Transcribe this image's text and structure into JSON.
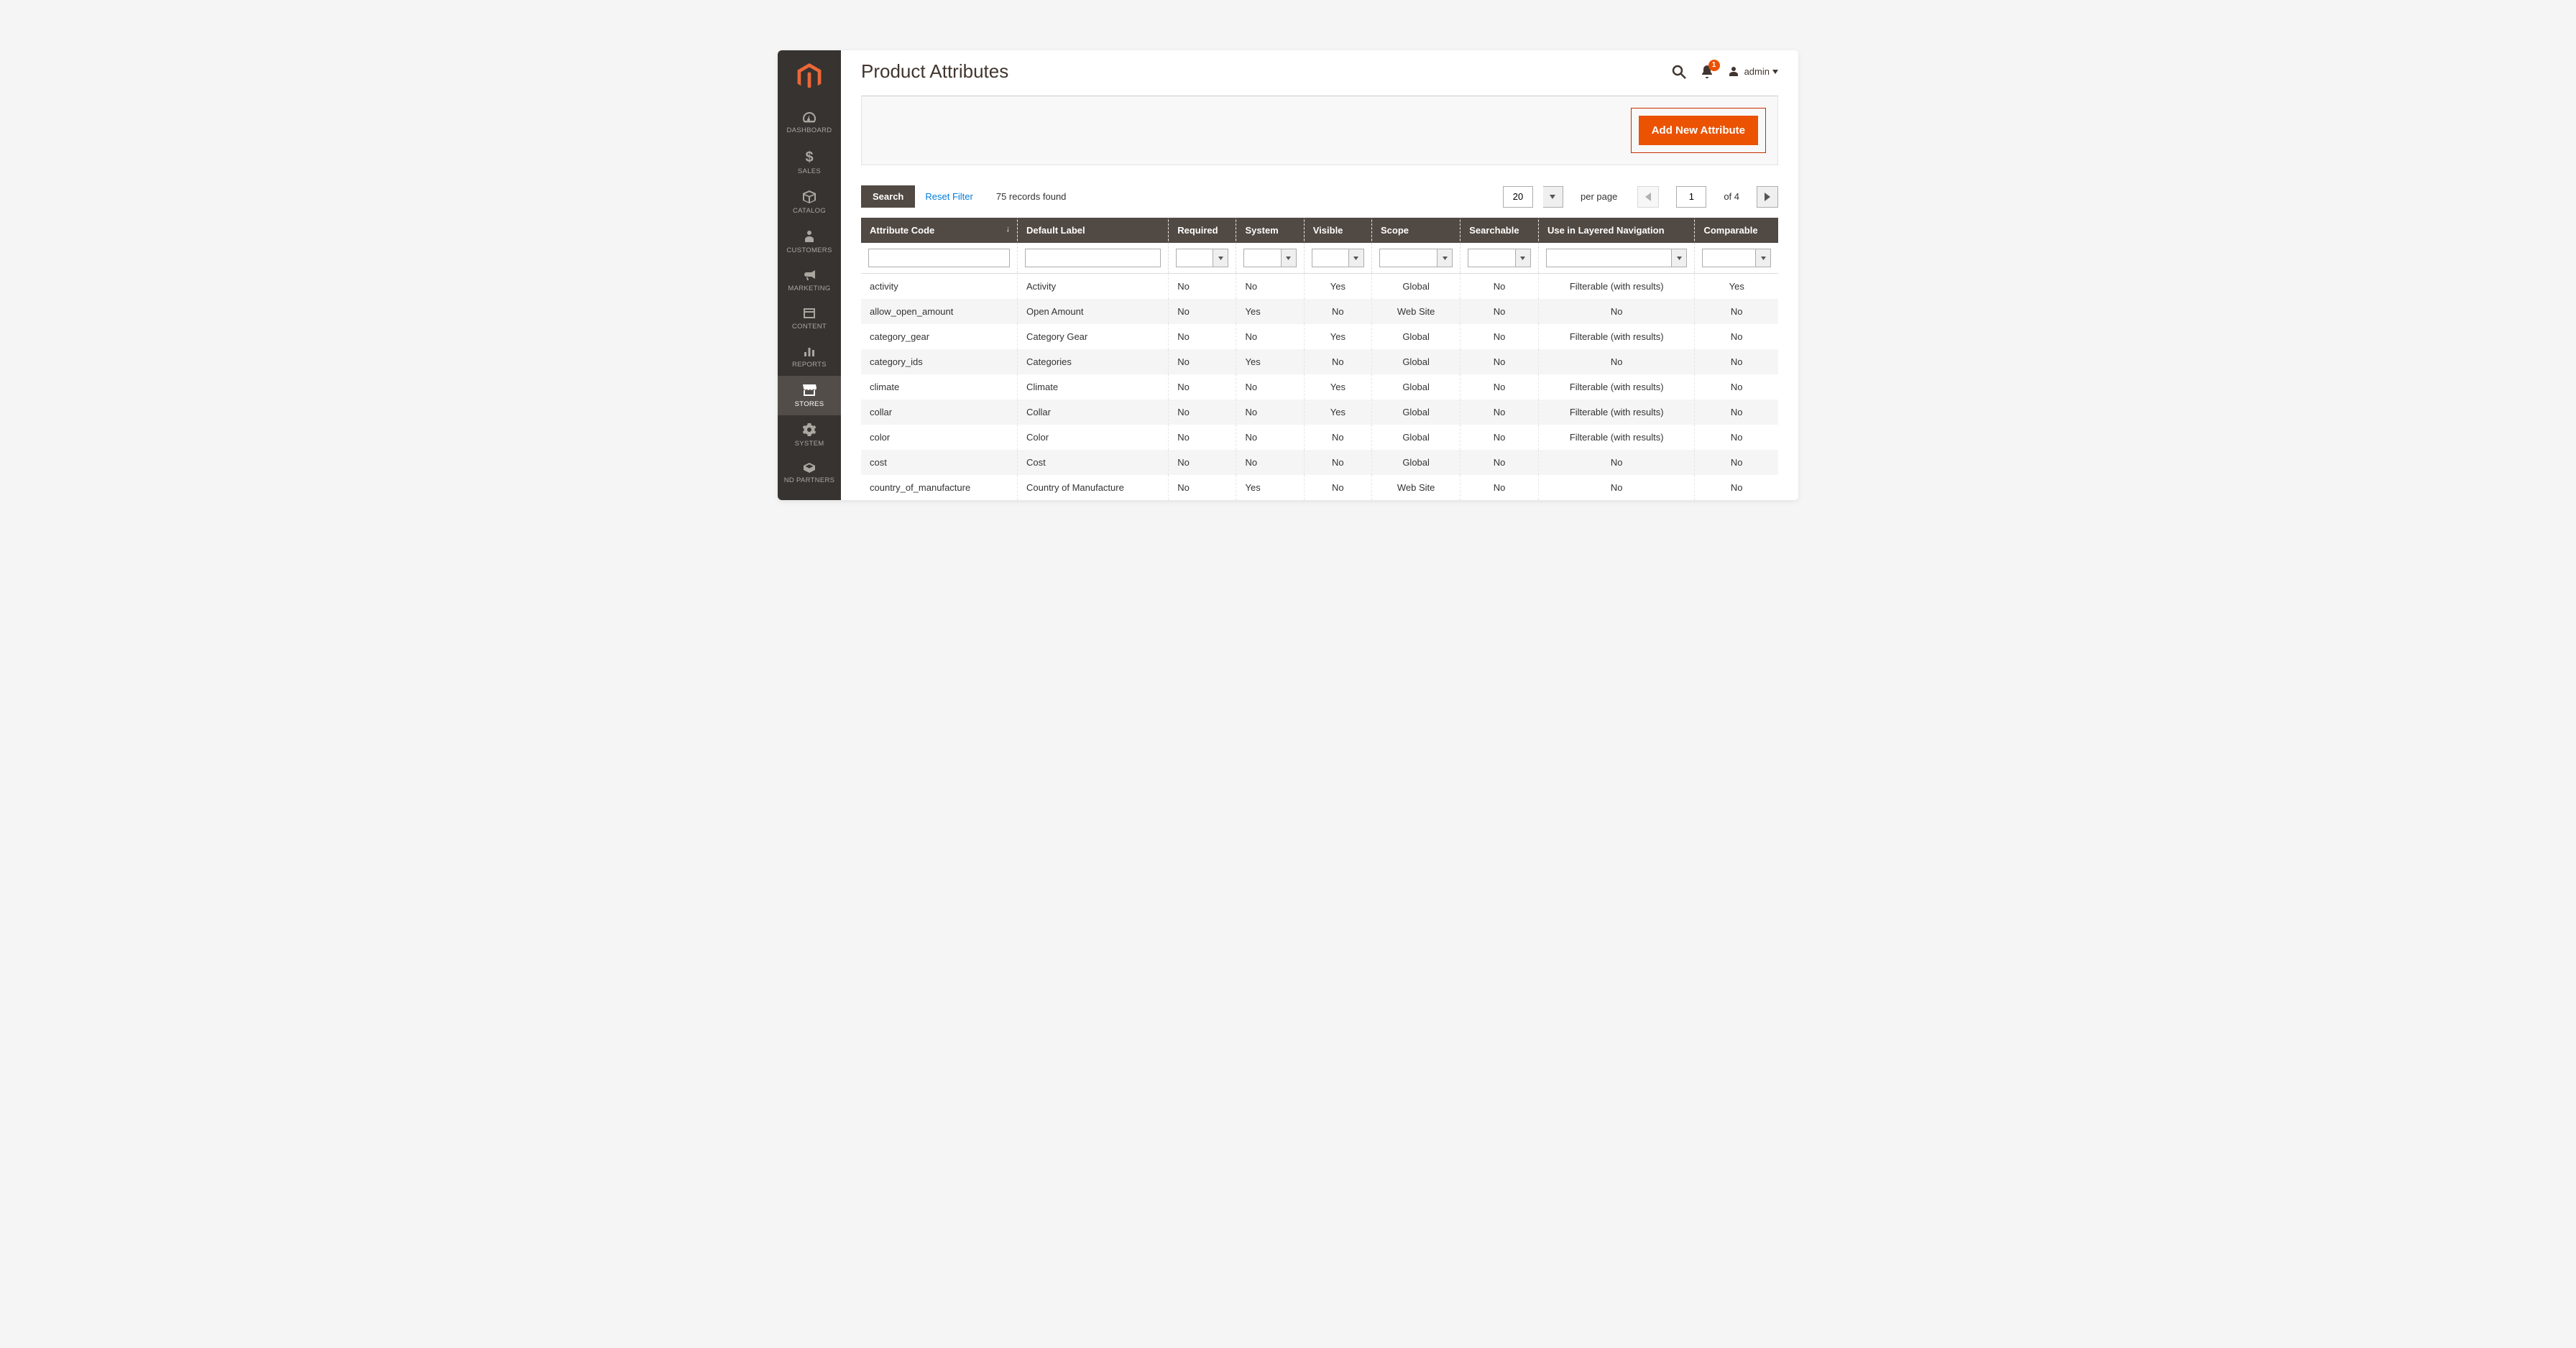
{
  "sidebar": {
    "items": [
      {
        "label": "DASHBOARD"
      },
      {
        "label": "SALES"
      },
      {
        "label": "CATALOG"
      },
      {
        "label": "CUSTOMERS"
      },
      {
        "label": "MARKETING"
      },
      {
        "label": "CONTENT"
      },
      {
        "label": "REPORTS"
      },
      {
        "label": "STORES"
      },
      {
        "label": "SYSTEM"
      },
      {
        "label": "ND PARTNERS"
      }
    ],
    "active_index": 7
  },
  "header": {
    "title": "Product Attributes",
    "notification_count": "1",
    "user_label": "admin"
  },
  "action_bar": {
    "add_button": "Add New Attribute"
  },
  "toolbar": {
    "search_label": "Search",
    "reset_label": "Reset Filter",
    "records_found": "75 records found",
    "page_size": "20",
    "per_page_label": "per page",
    "current_page": "1",
    "total_pages_label": "of 4"
  },
  "grid": {
    "columns": [
      "Attribute Code",
      "Default Label",
      "Required",
      "System",
      "Visible",
      "Scope",
      "Searchable",
      "Use in Layered Navigation",
      "Comparable"
    ],
    "rows": [
      {
        "code": "activity",
        "label": "Activity",
        "required": "No",
        "system": "No",
        "visible": "Yes",
        "scope": "Global",
        "searchable": "No",
        "layered": "Filterable (with results)",
        "comparable": "Yes"
      },
      {
        "code": "allow_open_amount",
        "label": "Open Amount",
        "required": "No",
        "system": "Yes",
        "visible": "No",
        "scope": "Web Site",
        "searchable": "No",
        "layered": "No",
        "comparable": "No"
      },
      {
        "code": "category_gear",
        "label": "Category Gear",
        "required": "No",
        "system": "No",
        "visible": "Yes",
        "scope": "Global",
        "searchable": "No",
        "layered": "Filterable (with results)",
        "comparable": "No"
      },
      {
        "code": "category_ids",
        "label": "Categories",
        "required": "No",
        "system": "Yes",
        "visible": "No",
        "scope": "Global",
        "searchable": "No",
        "layered": "No",
        "comparable": "No"
      },
      {
        "code": "climate",
        "label": "Climate",
        "required": "No",
        "system": "No",
        "visible": "Yes",
        "scope": "Global",
        "searchable": "No",
        "layered": "Filterable (with results)",
        "comparable": "No"
      },
      {
        "code": "collar",
        "label": "Collar",
        "required": "No",
        "system": "No",
        "visible": "Yes",
        "scope": "Global",
        "searchable": "No",
        "layered": "Filterable (with results)",
        "comparable": "No"
      },
      {
        "code": "color",
        "label": "Color",
        "required": "No",
        "system": "No",
        "visible": "No",
        "scope": "Global",
        "searchable": "No",
        "layered": "Filterable (with results)",
        "comparable": "No"
      },
      {
        "code": "cost",
        "label": "Cost",
        "required": "No",
        "system": "No",
        "visible": "No",
        "scope": "Global",
        "searchable": "No",
        "layered": "No",
        "comparable": "No"
      },
      {
        "code": "country_of_manufacture",
        "label": "Country of Manufacture",
        "required": "No",
        "system": "Yes",
        "visible": "No",
        "scope": "Web Site",
        "searchable": "No",
        "layered": "No",
        "comparable": "No"
      }
    ]
  }
}
